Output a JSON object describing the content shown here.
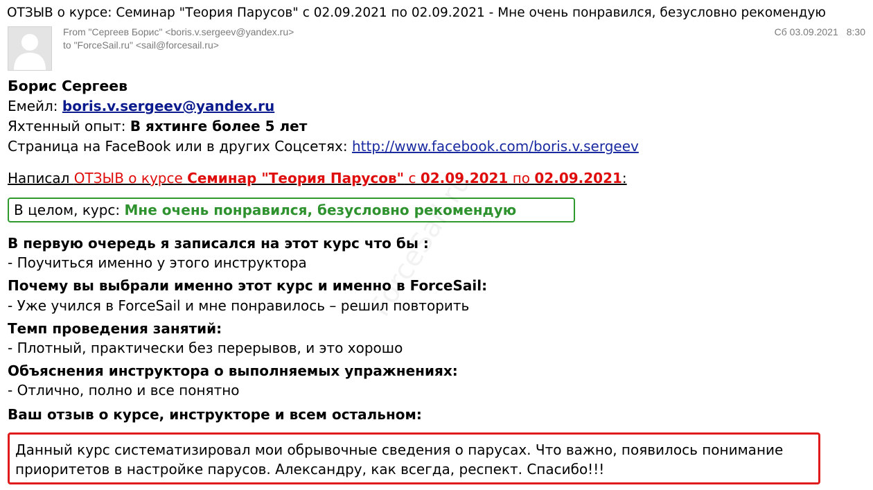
{
  "subject": "ОТЗЫВ о курсе: Семинар \"Теория Парусов\" с 02.09.2021 по 02.09.2021 - Мне очень понравился, безусловно рекомендую",
  "header": {
    "from_text": "From \"Сергеев Борис\" <boris.v.sergeev@yandex.ru>",
    "to_text": "to \"ForceSail.ru\" <sail@forcesail.ru>",
    "date": "Сб 03.09.2021",
    "time": "8:30"
  },
  "author": {
    "name": "Борис Сергеев",
    "email_label": "Емейл: ",
    "email": "boris.v.sergeev@yandex.ru",
    "experience_label": "Яхтенный опыт: ",
    "experience": "В яхтинге более 5 лет",
    "social_label": "Страница на FaceBook или в других Соцсетях: ",
    "social_url": "http://www.facebook.com/boris.v.sergeev"
  },
  "wrote": {
    "prefix": "Написал ",
    "review": "ОТЗЫВ о курсе ",
    "course": "Семинар \"Теория Парусов\"",
    "from_word": " с ",
    "date_from": "02.09.2021",
    "to_word": " по ",
    "date_to": "02.09.2021",
    "suffix": ":"
  },
  "overall": {
    "label": "В целом, курс: ",
    "value": "Мне очень понравился, безусловно рекомендую"
  },
  "questions": [
    {
      "q": "В первую очередь я записался на этот курс что бы :",
      "a": "- Поучиться именно у этого инструктора"
    },
    {
      "q": "Почему вы выбрали именно этот курс и именно в ForceSail:",
      "a": "- Уже учился в ForceSail и мне понравилось – решил повторить"
    },
    {
      "q": "Темп проведения занятий:",
      "a": "- Плотный, практически без перерывов, и это хорошо"
    },
    {
      "q": "Объяснения инструктора о выполняемых упражнениях:",
      "a": "- Отлично, полно и все понятно"
    },
    {
      "q": "Ваш отзыв о курсе, инструкторе и всем остальном:"
    }
  ],
  "review_text": "Данный курс систематизировал мои обрывочные сведения о парусах. Что важно, появилось понимание приоритетов в настройке парусов. Александру, как всегда, респект. Спасибо!!!",
  "watermark": "ForceSail.ru"
}
